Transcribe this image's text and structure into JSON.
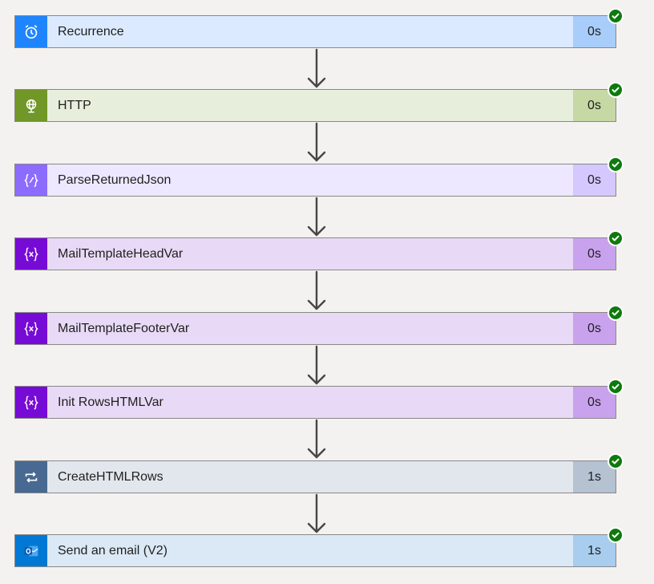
{
  "steps": [
    {
      "title": "Recurrence",
      "duration": "0s",
      "icon": "alarm-clock-icon",
      "accent": "#1f85ff",
      "bg": "#dbeafe",
      "durBg": "#a9cdfa"
    },
    {
      "title": "HTTP",
      "duration": "0s",
      "icon": "globe-icon",
      "accent": "#709727",
      "bg": "#e7efdc",
      "durBg": "#c6d8a4"
    },
    {
      "title": "ParseReturnedJson",
      "duration": "0s",
      "icon": "parse-json-icon",
      "accent": "#8c6cff",
      "bg": "#ede8ff",
      "durBg": "#d4c8ff"
    },
    {
      "title": "MailTemplateHeadVar",
      "duration": "0s",
      "icon": "variable-icon",
      "accent": "#770bd6",
      "bg": "#e8daf6",
      "durBg": "#c9a2ee"
    },
    {
      "title": "MailTemplateFooterVar",
      "duration": "0s",
      "icon": "variable-icon",
      "accent": "#770bd6",
      "bg": "#e8daf6",
      "durBg": "#c9a2ee"
    },
    {
      "title": "Init RowsHTMLVar",
      "duration": "0s",
      "icon": "variable-icon",
      "accent": "#770bd6",
      "bg": "#e8daf6",
      "durBg": "#c9a2ee"
    },
    {
      "title": "CreateHTMLRows",
      "duration": "1s",
      "icon": "loop-icon",
      "accent": "#486991",
      "bg": "#e2e7ee",
      "durBg": "#b4c2d1"
    },
    {
      "title": "Send an email (V2)",
      "duration": "1s",
      "icon": "outlook-icon",
      "accent": "#0078d4",
      "bg": "#dbe9f6",
      "durBg": "#a8cdee"
    }
  ],
  "status_icon": "success-check-icon",
  "arrow_icon": "arrow-down-icon"
}
